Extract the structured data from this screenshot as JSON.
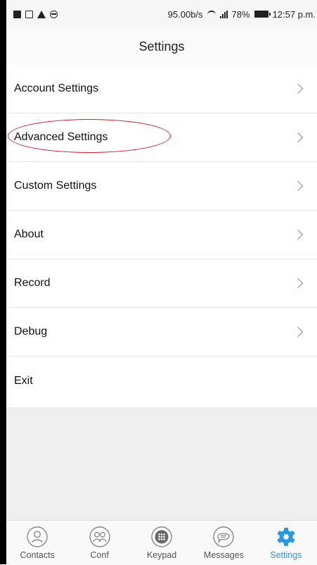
{
  "status_bar": {
    "speed": "95.00b/s",
    "battery": "78%",
    "time": "12:57 p.m."
  },
  "header": {
    "title": "Settings"
  },
  "settings_items": [
    {
      "label": "Account Settings",
      "has_chevron": true
    },
    {
      "label": "Advanced Settings",
      "has_chevron": true,
      "highlighted": true
    },
    {
      "label": "Custom Settings",
      "has_chevron": true
    },
    {
      "label": "About",
      "has_chevron": true
    },
    {
      "label": "Record",
      "has_chevron": true
    },
    {
      "label": "Debug",
      "has_chevron": true
    },
    {
      "label": "Exit",
      "has_chevron": false
    }
  ],
  "tabs": [
    {
      "label": "Contacts",
      "icon": "person-icon"
    },
    {
      "label": "Conf",
      "icon": "group-icon"
    },
    {
      "label": "Keypad",
      "icon": "keypad-icon"
    },
    {
      "label": "Messages",
      "icon": "chat-bubble-icon"
    },
    {
      "label": "Settings",
      "icon": "gear-icon",
      "active": true
    }
  ],
  "colors": {
    "accent": "#2a9adf",
    "annotation": "#d21f1f"
  }
}
